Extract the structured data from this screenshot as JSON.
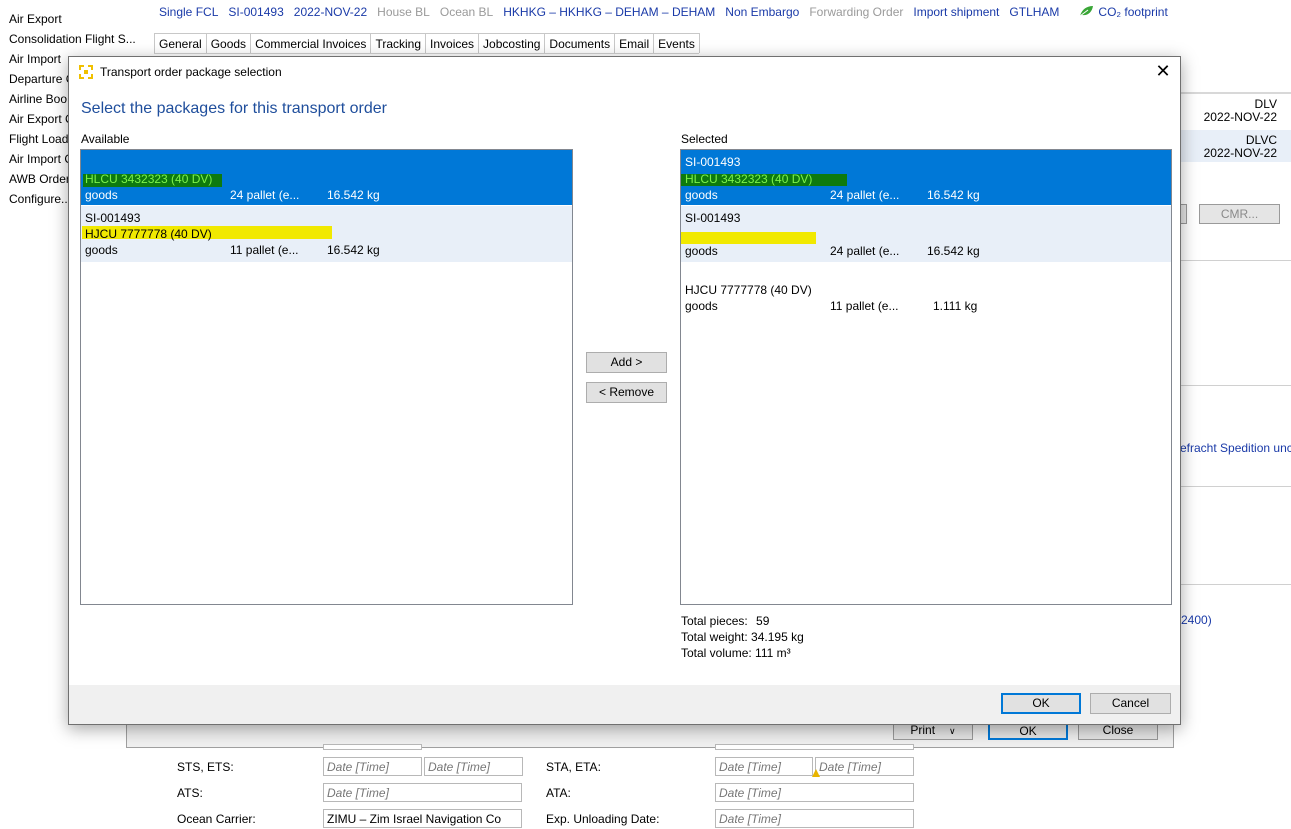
{
  "sidebar": {
    "items": [
      "Air Export",
      "Consolidation Flight S...",
      "Air Import",
      "Departure C",
      "Airline Boo",
      "Air Export C",
      "Flight Load",
      "Air Import C",
      "AWB Order",
      "Configure..."
    ]
  },
  "shipment_bar": {
    "type": "Single FCL",
    "id": "SI-001493",
    "date": "2022-NOV-22",
    "house_bl": "House BL",
    "ocean_bl": "Ocean BL",
    "route": "HKHKG – HKHKG – DEHAM – DEHAM",
    "embargo": "Non Embargo",
    "forwarding_order": "Forwarding Order",
    "import_shipment": "Import shipment",
    "office": "GTLHAM",
    "co2": "CO₂ footprint"
  },
  "tabs": [
    "General",
    "Goods",
    "Commercial Invoices",
    "Tracking",
    "Invoices",
    "Jobcosting",
    "Documents",
    "Email",
    "Events"
  ],
  "background": {
    "dlv": {
      "label": "DLV",
      "date": "2022-NOV-22"
    },
    "dlvc": {
      "label": "DLVC",
      "date": "2022-NOV-22"
    },
    "cmr_button": "CMR...",
    "partner_text": "efracht Spedition unc",
    "code_text": "2400)",
    "print_button": "Print",
    "ok_button": "OK",
    "close_button": "Close",
    "sts_ets_label": "STS, ETS:",
    "sta_eta_label": "STA, ETA:",
    "ats_label": "ATS:",
    "ata_label": "ATA:",
    "ocean_carrier_label": "Ocean Carrier:",
    "ocean_carrier_value": "ZIMU – Zim Israel Navigation Co",
    "exp_unloading_label": "Exp. Unloading Date:",
    "date_time_placeholder": "Date [Time]",
    "date_placeholder": "Date [Time]"
  },
  "dialog": {
    "title": "Transport order package selection",
    "heading": "Select the packages for this transport order",
    "available_label": "Available",
    "selected_label": "Selected",
    "add_button": "Add >",
    "remove_button": "< Remove",
    "ok_button": "OK",
    "cancel_button": "Cancel",
    "available": [
      {
        "ref": "",
        "container": "HLCU 3432323 (40 DV)",
        "desc": "goods",
        "qty": "24 pallet (e...",
        "weight": "16.542 kg"
      },
      {
        "ref": "SI-001493",
        "container": "HJCU 7777778 (40 DV)",
        "desc": "goods",
        "qty": "11 pallet (e...",
        "weight": "16.542 kg"
      }
    ],
    "selected": [
      {
        "ref": "SI-001493",
        "container": "HLCU 3432323 (40 DV)",
        "desc": "goods",
        "qty": "24 pallet (e...",
        "weight": "16.542 kg"
      },
      {
        "ref": "SI-001493",
        "container": "",
        "desc": "goods",
        "qty": "24 pallet (e...",
        "weight": "16.542 kg"
      },
      {
        "ref": "",
        "container": "HJCU 7777778 (40 DV)",
        "desc": "goods",
        "qty": "11 pallet (e...",
        "weight": "1.111 kg"
      }
    ],
    "totals": {
      "pieces_label": "Total pieces:",
      "pieces": "59",
      "weight_label": "Total weight:",
      "weight": "34.195 kg",
      "volume_label": "Total volume:",
      "volume": "111 m³"
    }
  },
  "colors": {
    "selection": "#0078d7",
    "link": "#1a3aa8",
    "highlight_green": "#0e7a0e",
    "highlight_yellow": "#f1e900"
  }
}
